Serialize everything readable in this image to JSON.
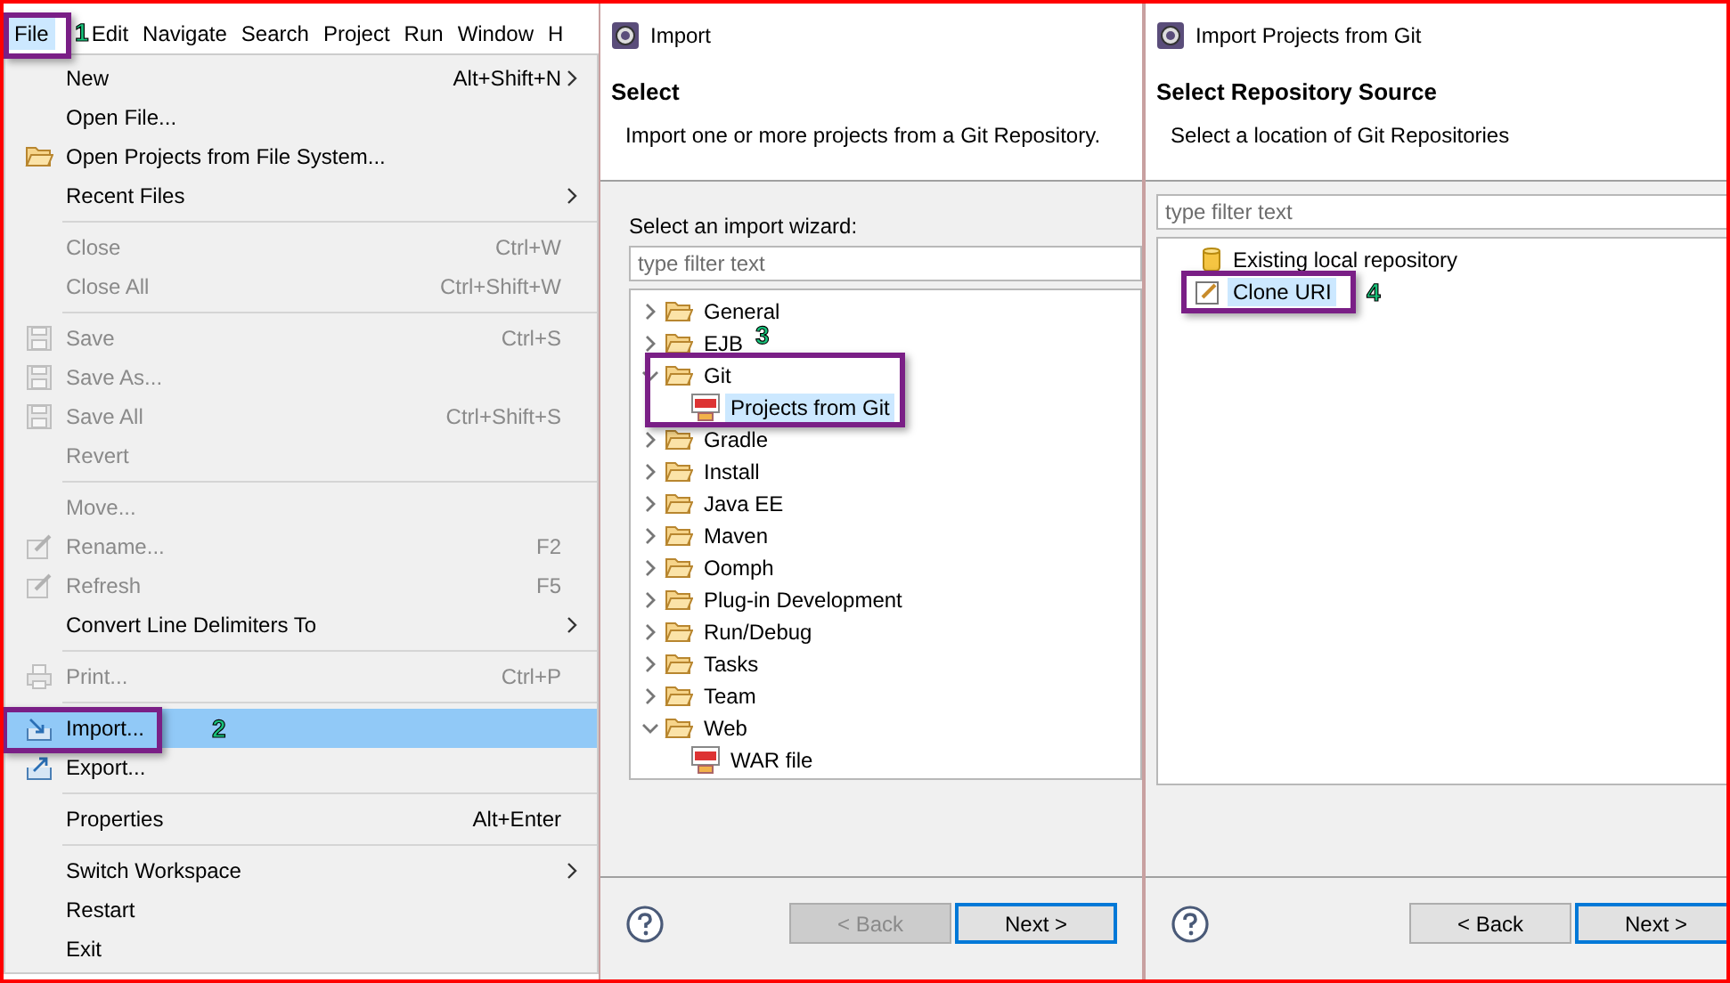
{
  "menubar": [
    {
      "label": "File",
      "selected": true,
      "callout": "1"
    },
    {
      "label": "Edit",
      "selected": false
    },
    {
      "label": "Navigate",
      "selected": false
    },
    {
      "label": "Search",
      "selected": false
    },
    {
      "label": "Project",
      "selected": false
    },
    {
      "label": "Run",
      "selected": false
    },
    {
      "label": "Window",
      "selected": false
    },
    {
      "label": "H",
      "selected": false
    }
  ],
  "file_menu": [
    {
      "kind": "item",
      "label": "New",
      "shortcut": "Alt+Shift+N",
      "submenu": true,
      "disabled": false,
      "selected": false
    },
    {
      "kind": "item",
      "label": "Open File...",
      "disabled": false,
      "selected": false
    },
    {
      "kind": "item",
      "label": "Open Projects from File System...",
      "disabled": false,
      "selected": false
    },
    {
      "kind": "item",
      "label": "Recent Files",
      "submenu": true,
      "disabled": false,
      "selected": false
    },
    {
      "kind": "separator"
    },
    {
      "kind": "item",
      "label": "Close",
      "shortcut": "Ctrl+W",
      "disabled": true,
      "selected": false
    },
    {
      "kind": "item",
      "label": "Close All",
      "shortcut": "Ctrl+Shift+W",
      "disabled": true,
      "selected": false
    },
    {
      "kind": "separator"
    },
    {
      "kind": "item",
      "label": "Save",
      "shortcut": "Ctrl+S",
      "disabled": true,
      "selected": false
    },
    {
      "kind": "item",
      "label": "Save As...",
      "disabled": true,
      "selected": false
    },
    {
      "kind": "item",
      "label": "Save All",
      "shortcut": "Ctrl+Shift+S",
      "disabled": true,
      "selected": false
    },
    {
      "kind": "item",
      "label": "Revert",
      "disabled": true,
      "selected": false
    },
    {
      "kind": "separator"
    },
    {
      "kind": "item",
      "label": "Move...",
      "disabled": true,
      "selected": false
    },
    {
      "kind": "item",
      "label": "Rename...",
      "shortcut": "F2",
      "disabled": true,
      "selected": false
    },
    {
      "kind": "item",
      "label": "Refresh",
      "shortcut": "F5",
      "disabled": true,
      "selected": false
    },
    {
      "kind": "item",
      "label": "Convert Line Delimiters To",
      "submenu": true,
      "disabled": false,
      "selected": false
    },
    {
      "kind": "separator"
    },
    {
      "kind": "item",
      "label": "Print...",
      "shortcut": "Ctrl+P",
      "disabled": true,
      "selected": false
    },
    {
      "kind": "separator"
    },
    {
      "kind": "item",
      "label": "Import...",
      "disabled": false,
      "selected": true,
      "callout": "2"
    },
    {
      "kind": "item",
      "label": "Export...",
      "disabled": false,
      "selected": false
    },
    {
      "kind": "separator"
    },
    {
      "kind": "item",
      "label": "Properties",
      "shortcut": "Alt+Enter",
      "disabled": false,
      "selected": false
    },
    {
      "kind": "separator"
    },
    {
      "kind": "item",
      "label": "Switch Workspace",
      "submenu": true,
      "disabled": false,
      "selected": false
    },
    {
      "kind": "item",
      "label": "Restart",
      "disabled": false,
      "selected": false
    },
    {
      "kind": "item",
      "label": "Exit",
      "disabled": false,
      "selected": false
    }
  ],
  "import_dialog": {
    "title": "Import",
    "heading": "Select",
    "description": "Import one or more projects from a Git Repository.",
    "wizard_label": "Select an import wizard:",
    "filter": {
      "placeholder": "type filter text"
    },
    "tree": [
      {
        "label": "General",
        "expanded": false,
        "selected": false
      },
      {
        "label": "EJB",
        "expanded": false,
        "selected": false
      },
      {
        "label": "Git",
        "expanded": true,
        "selected": false,
        "callout": "3",
        "children": [
          {
            "label": "Projects from Git",
            "selected": true
          }
        ]
      },
      {
        "label": "Gradle",
        "expanded": false,
        "selected": false
      },
      {
        "label": "Install",
        "expanded": false,
        "selected": false
      },
      {
        "label": "Java EE",
        "expanded": false,
        "selected": false
      },
      {
        "label": "Maven",
        "expanded": false,
        "selected": false
      },
      {
        "label": "Oomph",
        "expanded": false,
        "selected": false
      },
      {
        "label": "Plug-in Development",
        "expanded": false,
        "selected": false
      },
      {
        "label": "Run/Debug",
        "expanded": false,
        "selected": false
      },
      {
        "label": "Tasks",
        "expanded": false,
        "selected": false
      },
      {
        "label": "Team",
        "expanded": false,
        "selected": false
      },
      {
        "label": "Web",
        "expanded": true,
        "selected": false,
        "children": [
          {
            "label": "WAR file",
            "selected": false
          }
        ]
      }
    ],
    "buttons": [
      {
        "label": "< Back",
        "disabled": true,
        "default": false
      },
      {
        "label": "Next >",
        "disabled": false,
        "default": true
      }
    ]
  },
  "git_dialog": {
    "title": "Import Projects from Git",
    "heading": "Select Repository Source",
    "description": "Select a location of Git Repositories",
    "filter": {
      "placeholder": "type filter text"
    },
    "sources": [
      {
        "label": "Existing local repository",
        "selected": false
      },
      {
        "label": "Clone URI",
        "selected": true,
        "callout": "4"
      }
    ],
    "buttons": [
      {
        "label": "< Back",
        "disabled": false,
        "default": false
      },
      {
        "label": "Next >",
        "disabled": false,
        "default": true
      }
    ]
  }
}
